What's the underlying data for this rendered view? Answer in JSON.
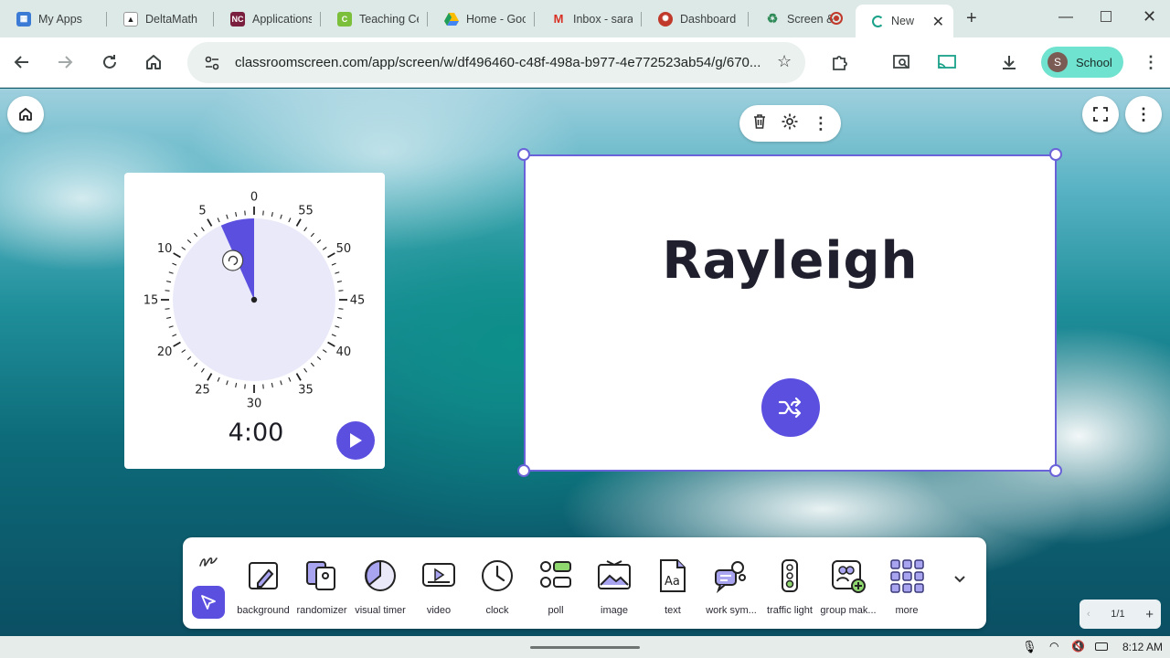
{
  "browser": {
    "tabs": [
      {
        "label": "My Apps",
        "icon": "grid-icon",
        "color": "#3b7bd6"
      },
      {
        "label": "DeltaMath",
        "icon": "delta-icon",
        "color": "#2e2e2e"
      },
      {
        "label": "Applications",
        "icon": "nc-icon",
        "color": "#7a1f3d"
      },
      {
        "label": "Teaching Cen",
        "icon": "c-icon",
        "color": "#7cbf3b"
      },
      {
        "label": "Home - Goo",
        "icon": "drive-icon",
        "color": "#1e9e5b"
      },
      {
        "label": "Inbox - sarah",
        "icon": "gmail-icon",
        "color": "#d93025"
      },
      {
        "label": "Dashboard",
        "icon": "dashboard-icon",
        "color": "#c0392b"
      },
      {
        "label": "Screen &",
        "icon": "recycle-icon",
        "color": "#2e8b57"
      },
      {
        "label": "New",
        "icon": "loading-icon",
        "color": "#1aa189",
        "active": true
      }
    ],
    "url": "classroomscreen.com/app/screen/w/df496460-c48f-498a-b977-4e772523ab54/g/670...",
    "profile": {
      "initial": "S",
      "label": "School"
    }
  },
  "timer": {
    "time": "4:00",
    "dial_labels": [
      "0",
      "55",
      "50",
      "45",
      "40",
      "35",
      "30",
      "25",
      "20",
      "15",
      "10",
      "5"
    ],
    "selected_minutes": 4
  },
  "randomizer": {
    "name": "Rayleigh"
  },
  "toolbar": {
    "tools": [
      {
        "label": "background",
        "icon": "background-icon"
      },
      {
        "label": "randomizer",
        "icon": "randomizer-icon"
      },
      {
        "label": "visual timer",
        "icon": "visual-timer-icon"
      },
      {
        "label": "video",
        "icon": "video-icon"
      },
      {
        "label": "clock",
        "icon": "clock-icon"
      },
      {
        "label": "poll",
        "icon": "poll-icon"
      },
      {
        "label": "image",
        "icon": "image-icon"
      },
      {
        "label": "text",
        "icon": "text-icon"
      },
      {
        "label": "work sym...",
        "icon": "work-symbols-icon"
      },
      {
        "label": "traffic light",
        "icon": "traffic-light-icon"
      },
      {
        "label": "group mak...",
        "icon": "group-maker-icon"
      },
      {
        "label": "more",
        "icon": "more-grid-icon"
      }
    ]
  },
  "pager": {
    "label": "1/1"
  },
  "system": {
    "time": "8:12 AM"
  },
  "colors": {
    "accent": "#5b4fe0",
    "accent_light": "#e9e9fa",
    "profile": "#6fe3cf"
  }
}
